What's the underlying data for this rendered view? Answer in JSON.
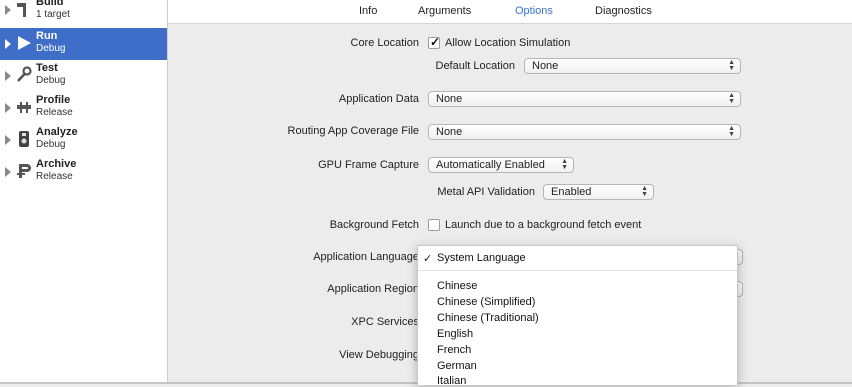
{
  "sidebar": {
    "items": [
      {
        "title": "Build",
        "subtitle": "1 target",
        "icon": "hammer-icon"
      },
      {
        "title": "Run",
        "subtitle": "Debug",
        "icon": "play-icon"
      },
      {
        "title": "Test",
        "subtitle": "Debug",
        "icon": "wrench-icon"
      },
      {
        "title": "Profile",
        "subtitle": "Release",
        "icon": "instruments-icon"
      },
      {
        "title": "Analyze",
        "subtitle": "Debug",
        "icon": "analyze-icon"
      },
      {
        "title": "Archive",
        "subtitle": "Release",
        "icon": "archive-icon"
      }
    ],
    "selected_index": 1
  },
  "tabs": [
    {
      "label": "Info"
    },
    {
      "label": "Arguments"
    },
    {
      "label": "Options"
    },
    {
      "label": "Diagnostics"
    }
  ],
  "active_tab": "Options",
  "form": {
    "core_location": {
      "label": "Core Location",
      "checkbox_label": "Allow Location Simulation",
      "checked": true,
      "default_location_label": "Default Location",
      "default_location_value": "None"
    },
    "application_data": {
      "label": "Application Data",
      "value": "None"
    },
    "routing": {
      "label": "Routing App Coverage File",
      "value": "None"
    },
    "gpu": {
      "label": "GPU Frame Capture",
      "value": "Automatically Enabled",
      "metal_label": "Metal API Validation",
      "metal_value": "Enabled"
    },
    "background_fetch": {
      "label": "Background Fetch",
      "checkbox_label": "Launch due to a background fetch event",
      "checked": false
    },
    "application_language": {
      "label": "Application Language"
    },
    "application_region": {
      "label": "Application Region"
    },
    "xpc_services": {
      "label": "XPC Services"
    },
    "view_debugging": {
      "label": "View Debugging"
    }
  },
  "language_menu": {
    "selected": "System Language",
    "options": [
      "Chinese",
      "Chinese (Simplified)",
      "Chinese (Traditional)",
      "English",
      "French",
      "German",
      "Italian"
    ]
  },
  "colors": {
    "selection": "#3f6ec9",
    "active_tab": "#3a73d1"
  }
}
